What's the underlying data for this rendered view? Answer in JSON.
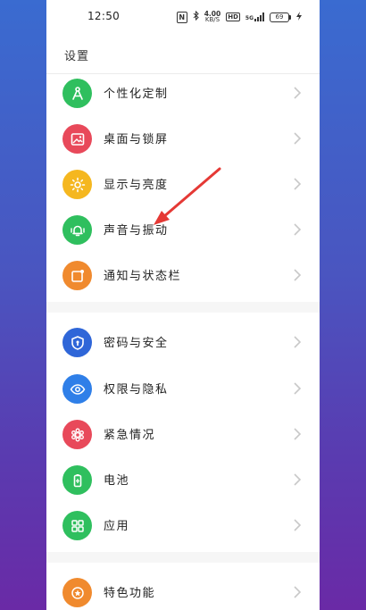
{
  "status_bar": {
    "time": "12:50",
    "nfc": "N",
    "speed_value": "4.00",
    "speed_unit": "KB/S",
    "hd": "HD",
    "signal": "5G",
    "battery": "69"
  },
  "header": {
    "title": "设置"
  },
  "settings": [
    {
      "label": "个性化定制",
      "icon": "personalize-icon",
      "color": "#2fbf5e"
    },
    {
      "label": "桌面与锁屏",
      "icon": "wallpaper-icon",
      "color": "#e8495a"
    },
    {
      "label": "显示与亮度",
      "icon": "brightness-icon",
      "color": "#f5b71f"
    },
    {
      "label": "声音与振动",
      "icon": "bell-icon",
      "color": "#2fbf5e"
    },
    {
      "label": "通知与状态栏",
      "icon": "notification-icon",
      "color": "#f08a2e"
    },
    {
      "label": "密码与安全",
      "icon": "security-icon",
      "color": "#2f66d8"
    },
    {
      "label": "权限与隐私",
      "icon": "privacy-icon",
      "color": "#2f7fe8"
    },
    {
      "label": "紧急情况",
      "icon": "emergency-icon",
      "color": "#e8495a"
    },
    {
      "label": "电池",
      "icon": "battery-icon",
      "color": "#2fbf5e"
    },
    {
      "label": "应用",
      "icon": "apps-icon",
      "color": "#2fbf5e"
    },
    {
      "label": "特色功能",
      "icon": "star-icon",
      "color": "#f08a2e"
    }
  ],
  "annotation": {
    "color": "#e53935"
  }
}
